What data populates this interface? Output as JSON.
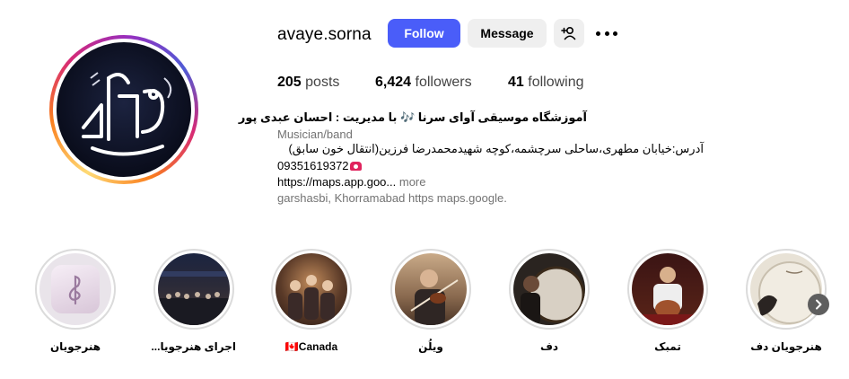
{
  "profile": {
    "username": "avaye.sorna",
    "follow_label": "Follow",
    "message_label": "Message",
    "stats": {
      "posts_count": "205",
      "posts_label": "posts",
      "followers_count": "6,424",
      "followers_label": "followers",
      "following_count": "41",
      "following_label": "following"
    },
    "bio": {
      "name": "آموزشگاه موسیقی آوای سرنا 🎶 با مدیریت : احسان عبدی پور",
      "category": "Musician/band",
      "address": "آدرس:خیابان مطهری،ساحلی سرچشمه،کوچه شهیدمحمدرضا فرزین(انتقال خون سابق)",
      "phone": "09351619372",
      "link": "https://maps.app.goo...",
      "more_label": "more",
      "location": "garshasbi, Khorramabad https maps.google."
    }
  },
  "highlights": [
    {
      "label": "هنرجویان"
    },
    {
      "label": "اجرای هنرجویا..."
    },
    {
      "label": "🇨🇦Canada"
    },
    {
      "label": "ویلُن"
    },
    {
      "label": "دف"
    },
    {
      "label": "تمبک"
    },
    {
      "label": "هنرجویان دف"
    }
  ],
  "icons": {
    "add_user": "person-plus-icon",
    "more": "more-options-icon",
    "next": "chevron-right-icon"
  },
  "colors": {
    "follow_button": "#4a5df9",
    "secondary_button": "#efefef",
    "muted_text": "#737373"
  }
}
